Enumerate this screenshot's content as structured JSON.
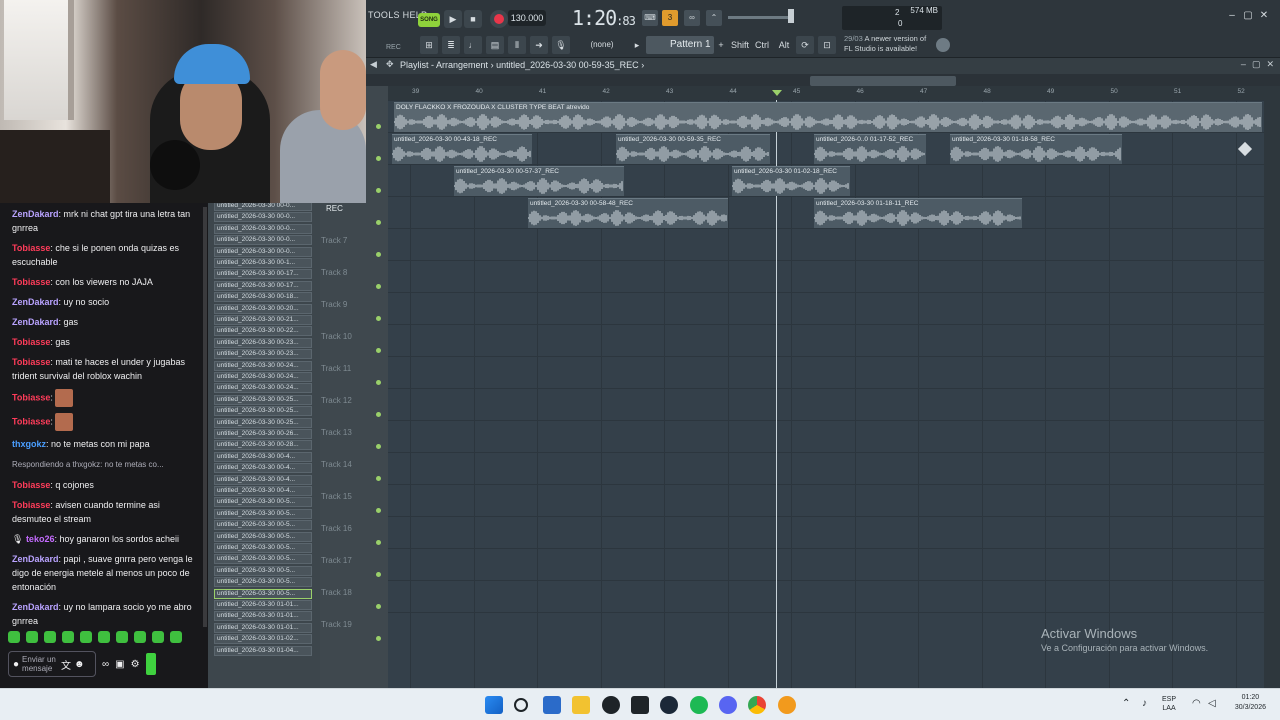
{
  "chat": {
    "messages": [
      {
        "user": "ZenDakard",
        "color": "#b9a3ff",
        "text": "mrk ni chat gpt tira una letra tan gnrrea"
      },
      {
        "user": "Tobiasse",
        "color": "#ff3c5a",
        "text": "che si le ponen onda quizas es escuchable"
      },
      {
        "user": "Tobiasse",
        "color": "#ff3c5a",
        "text": "con los viewers no JAJA"
      },
      {
        "user": "ZenDakard",
        "color": "#b9a3ff",
        "text": "uy no socio"
      },
      {
        "user": "ZenDakard",
        "color": "#b9a3ff",
        "text": "gas"
      },
      {
        "user": "Tobiasse",
        "color": "#ff3c5a",
        "text": "gas"
      },
      {
        "user": "Tobiasse",
        "color": "#ff3c5a",
        "text": "mati te haces el under y jugabas trident survival del roblox wachin"
      },
      {
        "user": "Tobiasse",
        "color": "#ff3c5a",
        "text": "",
        "emote": true
      },
      {
        "user": "Tobiasse",
        "color": "#ff3c5a",
        "text": "",
        "emote": true
      },
      {
        "user": "thxgokz",
        "color": "#4a9eff",
        "text": "no te metas con mi papa"
      },
      {
        "reply": "Respondiendo a thxgokz: no te metas co..."
      },
      {
        "user": "Tobiasse",
        "color": "#ff3c5a",
        "text": "q cojones"
      },
      {
        "user": "Tobiasse",
        "color": "#ff3c5a",
        "text": "avisen cuando termine asi desmuteo el stream"
      },
      {
        "user": "teko26",
        "color": "#c46bff",
        "text": "hoy ganaron los sordos acheii",
        "badge": true
      },
      {
        "user": "ZenDakard",
        "color": "#b9a3ff",
        "text": "papi , suave gnrra pero venga le digo de energia metele al menos un poco de entonación"
      },
      {
        "user": "ZenDakard",
        "color": "#b9a3ff",
        "text": "uy no lampara socio yo me abro gnrrea"
      }
    ],
    "input_placeholder": "Enviar un mensaje"
  },
  "browser": {
    "items": [
      "untitled_2026-03-30 00-0...",
      "untitled_2026-03-30 00-0...",
      "untitled_2026-03-30 00-0...",
      "untitled_2026-03-30 00-0...",
      "untitled_2026-03-30 00-0...",
      "untitled_2026-03-30 00-1...",
      "untitled_2026-03-30 00-17...",
      "untitled_2026-03-30 00-17...",
      "untitled_2026-03-30 00-18...",
      "untitled_2026-03-30 00-20...",
      "untitled_2026-03-30 00-21...",
      "untitled_2026-03-30 00-22...",
      "untitled_2026-03-30 00-23...",
      "untitled_2026-03-30 00-23...",
      "untitled_2026-03-30 00-24...",
      "untitled_2026-03-30 00-24...",
      "untitled_2026-03-30 00-24...",
      "untitled_2026-03-30 00-25...",
      "untitled_2026-03-30 00-25...",
      "untitled_2026-03-30 00-25...",
      "untitled_2026-03-30 00-26...",
      "untitled_2026-03-30 00-28...",
      "untitled_2026-03-30 00-4...",
      "untitled_2026-03-30 00-4...",
      "untitled_2026-03-30 00-4...",
      "untitled_2026-03-30 00-4...",
      "untitled_2026-03-30 00-5...",
      "untitled_2026-03-30 00-5...",
      "untitled_2026-03-30 00-5...",
      "untitled_2026-03-30 00-5...",
      "untitled_2026-03-30 00-5...",
      "untitled_2026-03-30 00-5...",
      "untitled_2026-03-30 00-5...",
      "untitled_2026-03-30 00-5...",
      "untitled_2026-03-30 00-5...",
      "untitled_2026-03-30 01-01...",
      "untitled_2026-03-30 01-01...",
      "untitled_2026-03-30 01-01...",
      "untitled_2026-03-30 01-02...",
      "untitled_2026-03-30 01-04..."
    ],
    "selected_index": 34
  },
  "toolbar": {
    "menu": "TOOLS HELP",
    "song_mode": "SONG",
    "tempo": "130.000",
    "time_main": "1:20",
    "time_sub": ":83",
    "cpu_value": "2",
    "voices": "0",
    "memory": "574 MB",
    "rec_label": "REC",
    "pattern_none": "(none)",
    "pattern": "Pattern 1",
    "mods": [
      "Shift",
      "Ctrl",
      "Alt"
    ],
    "news_date": "29/03",
    "news_text": "A newer version of",
    "news_text2": "FL Studio is available!"
  },
  "playlist": {
    "title": "Playlist - Arrangement",
    "breadcrumb": "untitled_2026-03-30 00-59-35_REC",
    "ruler": [
      "39",
      "40",
      "41",
      "42",
      "43",
      "44",
      "45",
      "46",
      "47",
      "48",
      "49",
      "50",
      "51",
      "52"
    ],
    "tracks": [
      "",
      "REC",
      "REC",
      "REC",
      "Track 7",
      "Track 8",
      "Track 9",
      "Track 10",
      "Track 11",
      "Track 12",
      "Track 13",
      "Track 14",
      "Track 15",
      "Track 16",
      "Track 17",
      "Track 18",
      "Track 19"
    ],
    "beat_clip": "DOLY FLACKKO X FROZOUDA X CLUSTER TYPE BEAT atrevido",
    "clips_row1": [
      "untitled_2026-03-30 00-43-18_REC",
      "untitled_2026-03-30 00-59-35_REC",
      "untitled_2026-0..0 01-17-52_REC",
      "untitled_2026-03-30 01-18-58_REC"
    ],
    "clips_row2": [
      "untitled_2026-03-30 00-57-37_REC",
      "untitled_2026-03-30 01-02-18_REC"
    ],
    "clips_row3": [
      "untitled_2026-03-30 00-58-48_REC",
      "untitled_2026-03-30 01-18-11_REC"
    ]
  },
  "watermark": {
    "line1": "Activar Windows",
    "line2": "Ve a Configuración para activar Windows."
  },
  "taskbar": {
    "lang1": "ESP",
    "lang2": "LAA",
    "time": "01:20",
    "date": "30/3/2026"
  }
}
